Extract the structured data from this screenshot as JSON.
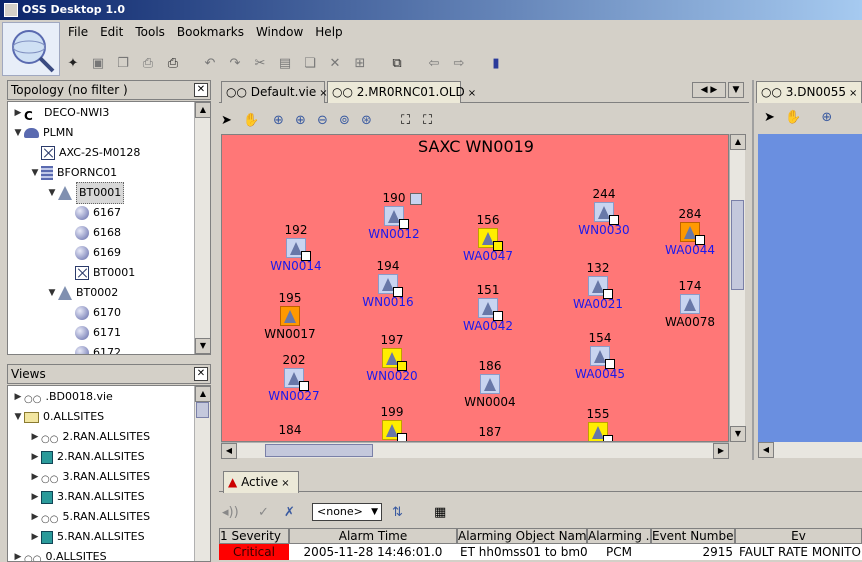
{
  "window": {
    "title": "OSS Desktop 1.0"
  },
  "menu": [
    "File",
    "Edit",
    "Tools",
    "Bookmarks",
    "Window",
    "Help"
  ],
  "toolbar": [
    "new-icon",
    "save-icon",
    "copy-icon",
    "print-icon",
    "print-preview-icon",
    "undo-icon",
    "redo-icon",
    "cut-icon",
    "paste-icon",
    "duplicate-icon",
    "delete-icon",
    "select-all-icon",
    "open-window-icon",
    "back-icon",
    "forward-icon",
    "bookmark-icon"
  ],
  "topology": {
    "header": "Topology (no filter )",
    "items": [
      {
        "label": "DECO-NWI3",
        "icon": "c-icon",
        "depth": 0,
        "expander": "›"
      },
      {
        "label": "PLMN",
        "icon": "plmn-icon",
        "depth": 0,
        "expander": "⌄"
      },
      {
        "label": "AXC-2S-M0128",
        "icon": "x-icon",
        "depth": 1,
        "expander": ""
      },
      {
        "label": "BFORNC01",
        "icon": "grid-icon",
        "depth": 1,
        "expander": "⌄"
      },
      {
        "label": "BT0001",
        "icon": "tower-icon",
        "depth": 2,
        "expander": "⌄",
        "selected": true
      },
      {
        "label": "6167",
        "icon": "sphere-icon",
        "depth": 3,
        "expander": ""
      },
      {
        "label": "6168",
        "icon": "sphere-icon",
        "depth": 3,
        "expander": ""
      },
      {
        "label": "6169",
        "icon": "sphere-icon",
        "depth": 3,
        "expander": ""
      },
      {
        "label": "BT0001",
        "icon": "x-icon",
        "depth": 3,
        "expander": ""
      },
      {
        "label": "BT0002",
        "icon": "tower-icon",
        "depth": 2,
        "expander": "⌄"
      },
      {
        "label": "6170",
        "icon": "sphere-icon",
        "depth": 3,
        "expander": ""
      },
      {
        "label": "6171",
        "icon": "sphere-icon",
        "depth": 3,
        "expander": ""
      },
      {
        "label": "6172",
        "icon": "sphere-icon",
        "depth": 3,
        "expander": ""
      }
    ]
  },
  "views": {
    "header": "Views",
    "items": [
      {
        "label": ".BD0018.vie",
        "icon": "glasses-icon",
        "depth": 0,
        "expander": "›"
      },
      {
        "label": "0.ALLSITES",
        "icon": "folder-icon",
        "depth": 0,
        "expander": "⌄"
      },
      {
        "label": "2.RAN.ALLSITES",
        "icon": "glasses-icon",
        "depth": 1,
        "expander": "›"
      },
      {
        "label": "2.RAN.ALLSITES",
        "icon": "book-icon",
        "depth": 1,
        "expander": "›"
      },
      {
        "label": "3.RAN.ALLSITES",
        "icon": "glasses-icon",
        "depth": 1,
        "expander": "›"
      },
      {
        "label": "3.RAN.ALLSITES",
        "icon": "book-icon",
        "depth": 1,
        "expander": "›"
      },
      {
        "label": "5.RAN.ALLSITES",
        "icon": "glasses-icon",
        "depth": 1,
        "expander": "›"
      },
      {
        "label": "5.RAN.ALLSITES",
        "icon": "book-icon",
        "depth": 1,
        "expander": "›"
      },
      {
        "label": "0.ALLSITES",
        "icon": "glasses-icon",
        "depth": 0,
        "expander": "›"
      }
    ]
  },
  "tabs": [
    {
      "label": "Default.vie",
      "active": false
    },
    {
      "label": "2.MR0RNC01.OLD",
      "active": true
    }
  ],
  "tab_right": {
    "label": "3.DN0055"
  },
  "map": {
    "title": "SAXC WN0019",
    "background": "#ff7777",
    "nodes": [
      {
        "num": "190",
        "label": "WN0012",
        "color": "blue",
        "badge": "white",
        "extra": true
      },
      {
        "num": "244",
        "label": "WN0030",
        "color": "blue",
        "badge": "white"
      },
      {
        "num": "192",
        "label": "WN0014",
        "color": "blue",
        "badge": "white"
      },
      {
        "num": "156",
        "label": "WA0047",
        "color": "yellow",
        "badge": "yellow"
      },
      {
        "num": "284",
        "label": "WA0044",
        "color": "orange",
        "badge": "white"
      },
      {
        "num": "194",
        "label": "WN0016",
        "color": "blue",
        "badge": "white"
      },
      {
        "num": "132",
        "label": "WA0021",
        "color": "blue",
        "badge": "white"
      },
      {
        "num": "195",
        "label": "WN0017",
        "color": "orange",
        "badge": "",
        "black": true
      },
      {
        "num": "151",
        "label": "WA0042",
        "color": "blue",
        "badge": "white"
      },
      {
        "num": "174",
        "label": "WA0078",
        "color": "blue",
        "badge": "",
        "black": true
      },
      {
        "num": "197",
        "label": "WN0020",
        "color": "yellow",
        "badge": "yellow"
      },
      {
        "num": "154",
        "label": "WA0045",
        "color": "blue",
        "badge": "white"
      },
      {
        "num": "202",
        "label": "WN0027",
        "color": "blue",
        "badge": "white"
      },
      {
        "num": "186",
        "label": "WN0004",
        "color": "blue",
        "badge": "",
        "black": true
      },
      {
        "num": "199",
        "label": "",
        "color": "yellow",
        "badge": "white"
      },
      {
        "num": "155",
        "label": "",
        "color": "yellow",
        "badge": "white"
      },
      {
        "num": "184",
        "label": "",
        "color": "",
        "badge": ""
      },
      {
        "num": "187",
        "label": "",
        "color": "",
        "badge": ""
      }
    ]
  },
  "alarms": {
    "tab": "Active",
    "filter": "<none>",
    "columns": [
      "1 Severity",
      "Alarm Time",
      "Alarming Object Name",
      "Alarming ...",
      "Event Number",
      "Ev"
    ],
    "rows": [
      {
        "severity": "Critical",
        "time": "2005-11-28 14:46:01.0",
        "object": "ET hh0mss01 to bm0...",
        "alarming": "PCM",
        "event_number": "2915",
        "text": "FAULT RATE MONITORIN"
      }
    ]
  },
  "colors": {
    "critical": "#ff0000",
    "link": "#1a1aee",
    "canvas": "#ff7777",
    "right_canvas": "#6a8fe0"
  }
}
